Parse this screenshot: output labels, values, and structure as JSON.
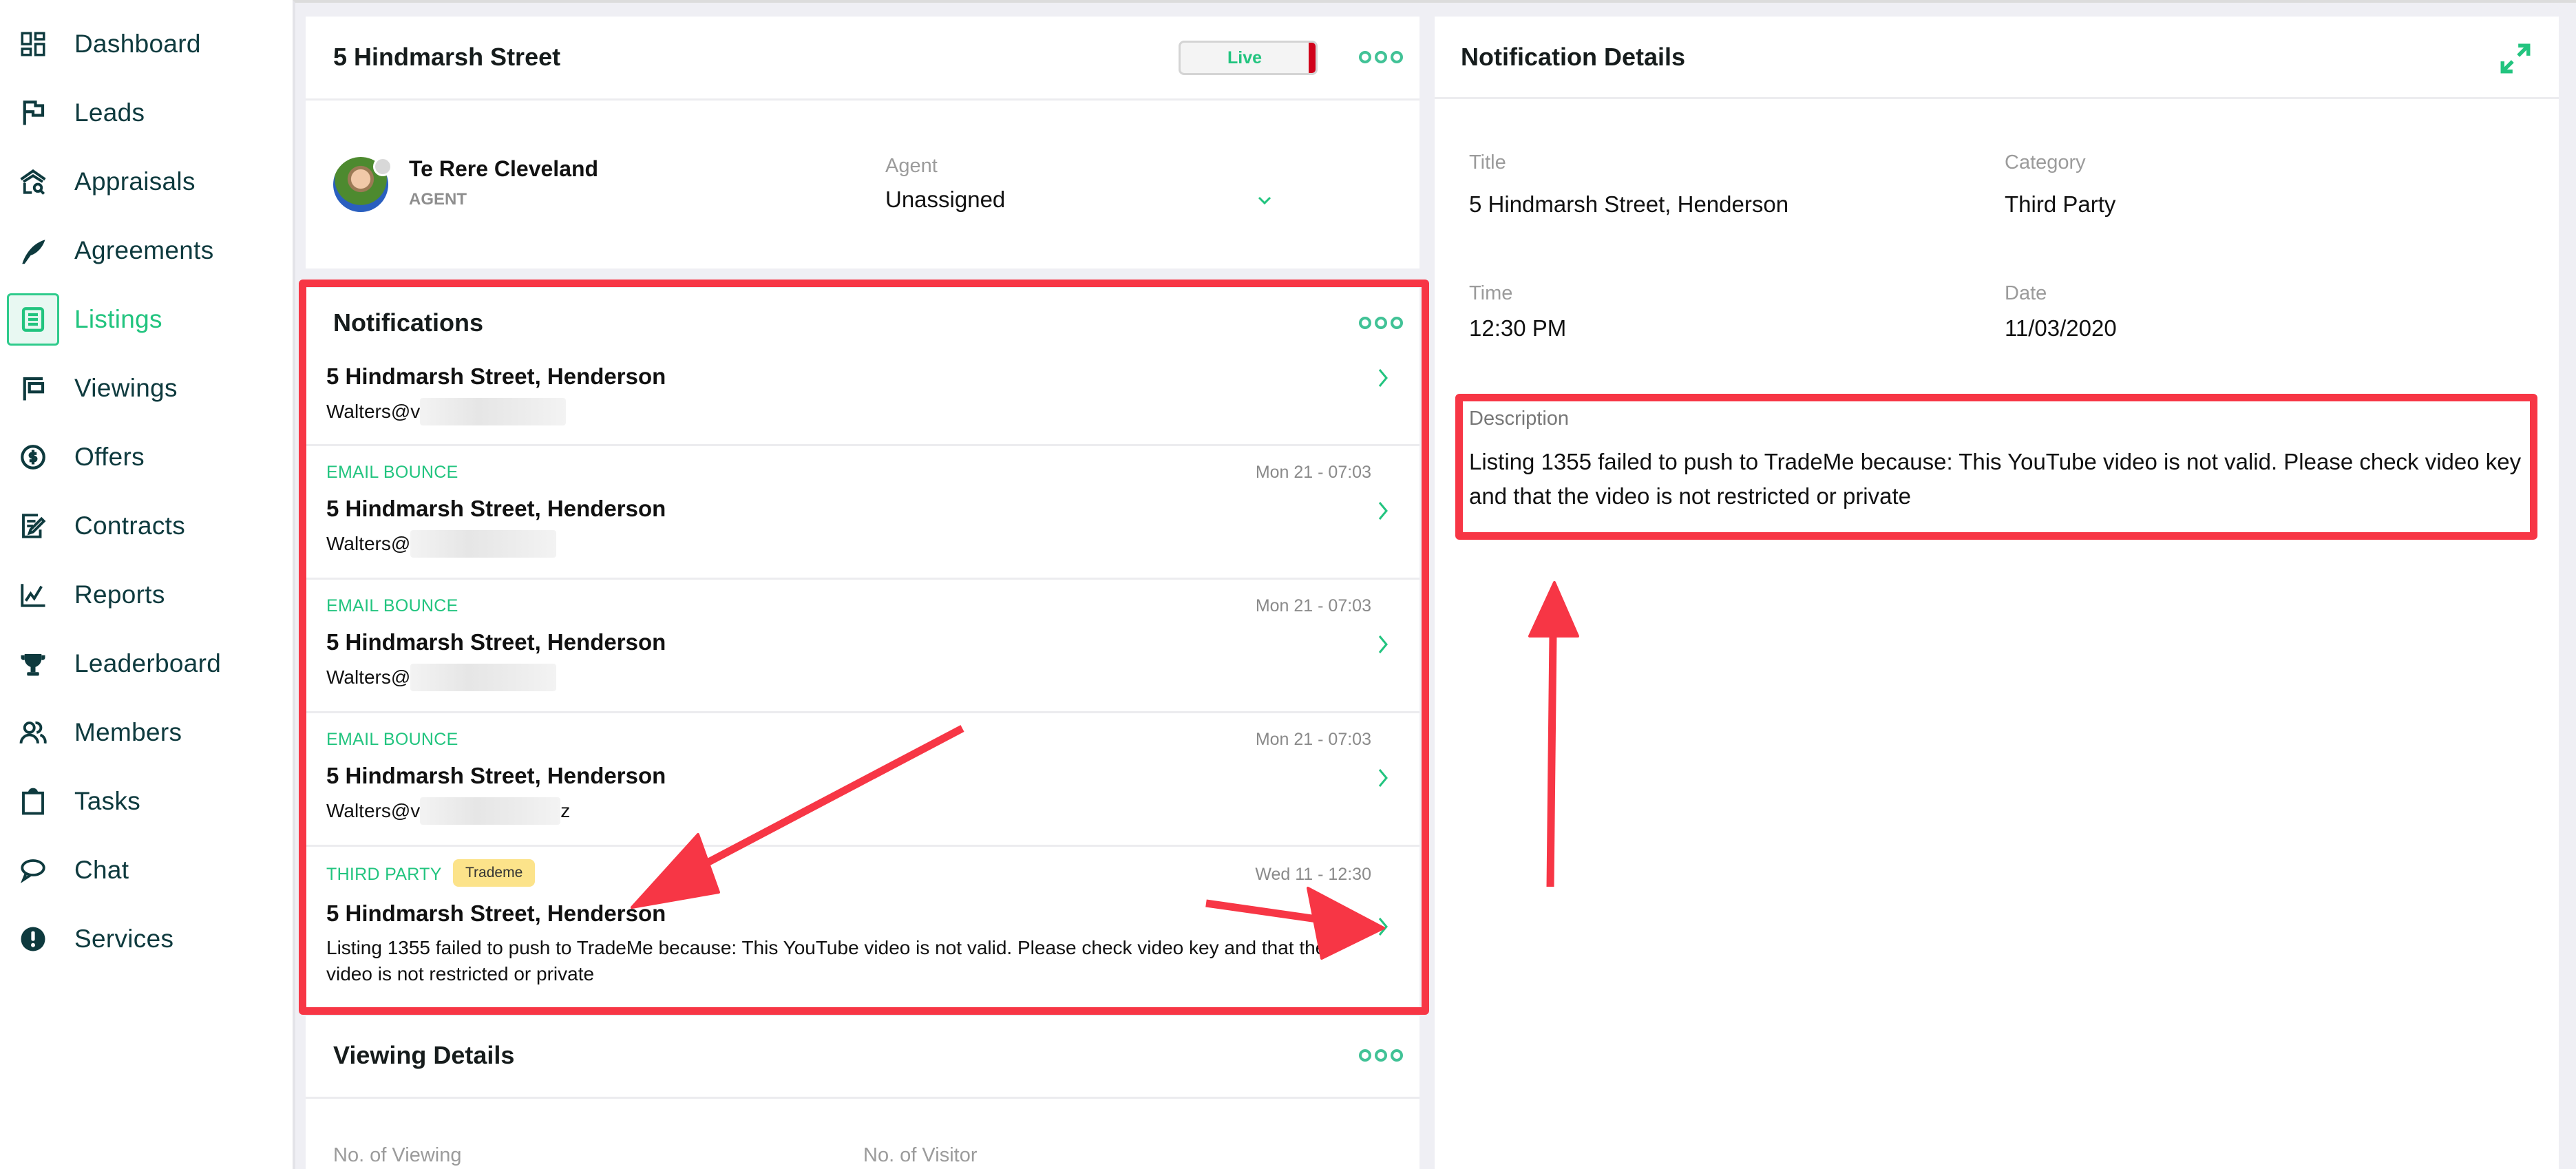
{
  "sidebar": {
    "items": [
      {
        "label": "Dashboard",
        "icon": "dashboard-icon",
        "active": false
      },
      {
        "label": "Leads",
        "icon": "flag-icon",
        "active": false
      },
      {
        "label": "Appraisals",
        "icon": "house-search-icon",
        "active": false
      },
      {
        "label": "Agreements",
        "icon": "quill-icon",
        "active": false
      },
      {
        "label": "Listings",
        "icon": "list-document-icon",
        "active": true
      },
      {
        "label": "Viewings",
        "icon": "signboard-icon",
        "active": false
      },
      {
        "label": "Offers",
        "icon": "dollar-circle-icon",
        "active": false
      },
      {
        "label": "Contracts",
        "icon": "contract-edit-icon",
        "active": false
      },
      {
        "label": "Reports",
        "icon": "line-chart-icon",
        "active": false
      },
      {
        "label": "Leaderboard",
        "icon": "trophy-icon",
        "active": false
      },
      {
        "label": "Members",
        "icon": "members-icon",
        "active": false
      },
      {
        "label": "Tasks",
        "icon": "clipboard-icon",
        "active": false
      },
      {
        "label": "Chat",
        "icon": "chat-bubble-icon",
        "active": false
      },
      {
        "label": "Services",
        "icon": "alert-circle-icon",
        "active": false
      }
    ]
  },
  "property": {
    "title": "5 Hindmarsh Street",
    "status_label": "Live",
    "contact_name": "Te Rere Cleveland",
    "contact_role": "AGENT",
    "agent_label": "Agent",
    "agent_value": "Unassigned"
  },
  "notifications": {
    "title": "Notifications",
    "items": [
      {
        "category": "",
        "time": "",
        "title": "5 Hindmarsh Street, Henderson",
        "email_prefix": "Walters@v",
        "email_suffix": ""
      },
      {
        "category": "EMAIL BOUNCE",
        "time": "Mon 21 - 07:03",
        "title": "5 Hindmarsh Street, Henderson",
        "email_prefix": "Walters@",
        "email_suffix": ""
      },
      {
        "category": "EMAIL BOUNCE",
        "time": "Mon 21 - 07:03",
        "title": "5 Hindmarsh Street, Henderson",
        "email_prefix": "Walters@",
        "email_suffix": ""
      },
      {
        "category": "EMAIL BOUNCE",
        "time": "Mon 21 - 07:03",
        "title": "5 Hindmarsh Street, Henderson",
        "email_prefix": "Walters@v",
        "email_suffix": "z"
      },
      {
        "category": "THIRD PARTY",
        "tag": "Trademe",
        "time": "Wed 11 - 12:30",
        "title": "5 Hindmarsh Street, Henderson",
        "description": "Listing 1355 failed to push to TradeMe because: This YouTube video is not valid. Please check video key and that the video is not restricted or private"
      }
    ]
  },
  "viewing_details": {
    "title": "Viewing Details",
    "no_of_viewing_label": "No. of Viewing",
    "no_of_visitor_label": "No. of Visitor"
  },
  "notification_details": {
    "title": "Notification Details",
    "title_label": "Title",
    "title_value": "5 Hindmarsh Street, Henderson",
    "category_label": "Category",
    "category_value": "Third Party",
    "time_label": "Time",
    "time_value": "12:30 PM",
    "date_label": "Date",
    "date_value": "11/03/2020",
    "description_label": "Description",
    "description_value": "Listing 1355 failed to push to TradeMe because: This YouTube video is not valid. Please check video key and that the video is not restricted or private"
  },
  "colors": {
    "accent": "#22c47f",
    "live_bar": "#d0021b",
    "annotation": "#f73645",
    "tag_bg": "#fce38a",
    "nav_text": "#0e3a3e"
  }
}
